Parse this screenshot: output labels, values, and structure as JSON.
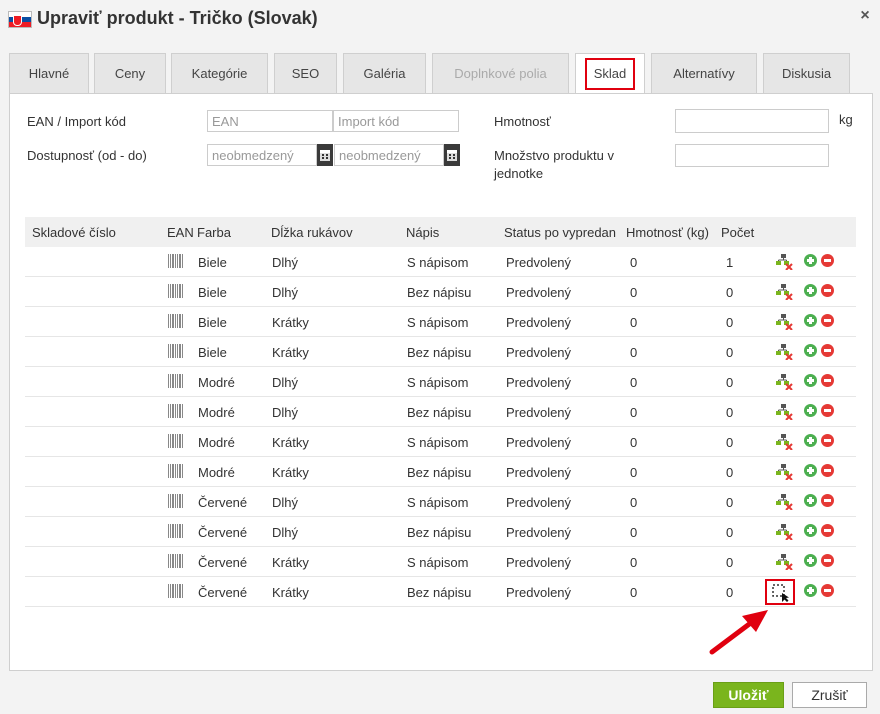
{
  "window": {
    "title": "Upraviť produkt - Tričko (Slovak)",
    "close_symbol": "×"
  },
  "tabs": [
    {
      "label": "Hlavné"
    },
    {
      "label": "Ceny"
    },
    {
      "label": "Kategórie"
    },
    {
      "label": "SEO"
    },
    {
      "label": "Galéria"
    },
    {
      "label": "Doplnkové polia"
    },
    {
      "label": "Sklad"
    },
    {
      "label": "Alternatívy"
    },
    {
      "label": "Diskusia"
    }
  ],
  "form": {
    "ean_label": "EAN / Import kód",
    "ean_placeholder": "EAN",
    "import_placeholder": "Import kód",
    "availability_label": "Dostupnosť (od - do)",
    "from_placeholder": "neobmedzený",
    "to_placeholder": "neobmedzený",
    "weight_label": "Hmotnosť",
    "weight_unit": "kg",
    "qty_label_line1": "Množstvo produktu v",
    "qty_label_line2": "jednotke"
  },
  "table": {
    "headers": [
      "Skladové číslo",
      "EAN",
      "Farba",
      "Dĺžka rukávov",
      "Nápis",
      "Status po vypredan",
      "Hmotnosť (kg)",
      "Počet"
    ],
    "rows": [
      {
        "farba": "Biele",
        "dlzka": "Dlhý",
        "napis": "S nápisom",
        "status": "Predvolený",
        "hmotnost": "0",
        "pocet": "1"
      },
      {
        "farba": "Biele",
        "dlzka": "Dlhý",
        "napis": "Bez nápisu",
        "status": "Predvolený",
        "hmotnost": "0",
        "pocet": "0"
      },
      {
        "farba": "Biele",
        "dlzka": "Krátky",
        "napis": "S nápisom",
        "status": "Predvolený",
        "hmotnost": "0",
        "pocet": "0"
      },
      {
        "farba": "Biele",
        "dlzka": "Krátky",
        "napis": "Bez nápisu",
        "status": "Predvolený",
        "hmotnost": "0",
        "pocet": "0"
      },
      {
        "farba": "Modré",
        "dlzka": "Dlhý",
        "napis": "S nápisom",
        "status": "Predvolený",
        "hmotnost": "0",
        "pocet": "0"
      },
      {
        "farba": "Modré",
        "dlzka": "Dlhý",
        "napis": "Bez nápisu",
        "status": "Predvolený",
        "hmotnost": "0",
        "pocet": "0"
      },
      {
        "farba": "Modré",
        "dlzka": "Krátky",
        "napis": "S nápisom",
        "status": "Predvolený",
        "hmotnost": "0",
        "pocet": "0"
      },
      {
        "farba": "Modré",
        "dlzka": "Krátky",
        "napis": "Bez nápisu",
        "status": "Predvolený",
        "hmotnost": "0",
        "pocet": "0"
      },
      {
        "farba": "Červené",
        "dlzka": "Dlhý",
        "napis": "S nápisom",
        "status": "Predvolený",
        "hmotnost": "0",
        "pocet": "0"
      },
      {
        "farba": "Červené",
        "dlzka": "Dlhý",
        "napis": "Bez nápisu",
        "status": "Predvolený",
        "hmotnost": "0",
        "pocet": "0"
      },
      {
        "farba": "Červené",
        "dlzka": "Krátky",
        "napis": "S nápisom",
        "status": "Predvolený",
        "hmotnost": "0",
        "pocet": "0"
      },
      {
        "farba": "Červené",
        "dlzka": "Krátky",
        "napis": "Bez nápisu",
        "status": "Predvolený",
        "hmotnost": "0",
        "pocet": "0"
      }
    ]
  },
  "buttons": {
    "save": "Uložiť",
    "cancel": "Zrušiť"
  },
  "colors": {
    "accent_green": "#7ab51d",
    "highlight_red": "#e0000f"
  },
  "icons": [
    "slovak-flag-icon",
    "close-icon",
    "calendar-icon",
    "barcode-icon",
    "tree-delete-icon",
    "plus-icon",
    "minus-icon",
    "selection-cursor-icon",
    "arrow-annotation-icon"
  ]
}
